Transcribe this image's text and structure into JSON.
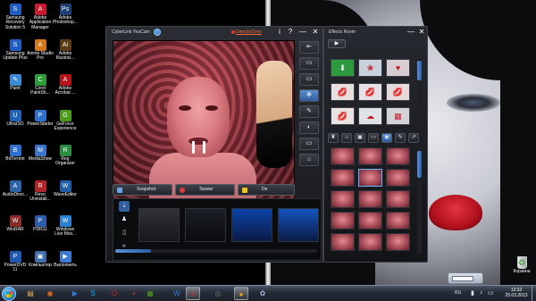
{
  "desktop": {
    "icons": [
      {
        "label": "Samsung Recovery Solution 5",
        "glyph": "S",
        "color": "#1f5fc4"
      },
      {
        "label": "Adobe Application Manager",
        "glyph": "A",
        "color": "#c8192e"
      },
      {
        "label": "Adobe Photoshop...",
        "glyph": "Ps",
        "color": "#1d3f73"
      },
      {
        "label": "Samsung Update Plus",
        "glyph": "S",
        "color": "#1f5fc4"
      },
      {
        "label": "Anime Studio Pro",
        "glyph": "A",
        "color": "#d47a1c"
      },
      {
        "label": "Adobe Illustrat...",
        "glyph": "Ai",
        "color": "#5b3b13"
      },
      {
        "label": "Paint",
        "glyph": "✎",
        "color": "#3a8ad6"
      },
      {
        "label": "Corel PaintSh...",
        "glyph": "C",
        "color": "#2f9a3a"
      },
      {
        "label": "Adobe Acrobat ...",
        "glyph": "A",
        "color": "#b8131d"
      },
      {
        "label": "UltraISO",
        "glyph": "U",
        "color": "#2063b7"
      },
      {
        "label": "PowerStarter",
        "glyph": "P",
        "color": "#2f6fd0"
      },
      {
        "label": "GeForce Experience",
        "glyph": "G",
        "color": "#4c9b1c"
      },
      {
        "label": "BitTorrent",
        "glyph": "B",
        "color": "#2f6fd0"
      },
      {
        "label": "MediaShow",
        "glyph": "M",
        "color": "#3c74c9"
      },
      {
        "label": "Reg Organizer",
        "glyph": "R",
        "color": "#2b8d3f"
      },
      {
        "label": "AudioDirec...",
        "glyph": "A",
        "color": "#2c63a8"
      },
      {
        "label": "Revo Uninstall...",
        "glyph": "R",
        "color": "#b02626"
      },
      {
        "label": "WaveEditor",
        "glyph": "W",
        "color": "#1f5fa8"
      },
      {
        "label": "WinRAR",
        "glyph": "W",
        "color": "#8b2a2a"
      },
      {
        "label": "PDR11",
        "glyph": "P",
        "color": "#2b5ca7"
      },
      {
        "label": "Windows Live Mov...",
        "glyph": "W",
        "color": "#2a7fd0"
      },
      {
        "label": "PowerDVD 11",
        "glyph": "P",
        "color": "#1d5bb3"
      },
      {
        "label": "Компьютер",
        "glyph": "▣",
        "color": "#3d6fa8"
      },
      {
        "label": "Выполнить",
        "glyph": "▶",
        "color": "#3a7ad0"
      }
    ],
    "recycle_bin_label": "Корзина"
  },
  "youcam": {
    "title": "CyberLink YouCam",
    "directorzone_label": "DirectorZone",
    "help_glyph": "?",
    "info_glyph": "i",
    "minimize_glyph": "—",
    "close_glyph": "✕",
    "snapshot_label": "Snapshot",
    "record_label": "Захват",
    "third_button_label": "De",
    "side_tools": [
      "⇤",
      "▭",
      "▭",
      "❃",
      "✎",
      "◐",
      "▭",
      "⌂"
    ],
    "filmstrip_nav": [
      "⇣",
      "♟",
      "▯",
      "»"
    ]
  },
  "effects_room": {
    "title": "Effects Room",
    "category_glyph": "▶",
    "minimize_glyph": "—",
    "close_glyph": "✕",
    "effect_tiles": [
      {
        "glyph": "⬇",
        "color": "#2c9a3f"
      },
      {
        "glyph": "❀",
        "color": "#c9d1dc"
      },
      {
        "glyph": "♥",
        "color": "#d8cdd0"
      },
      {
        "glyph": "💋",
        "color": "#e8dfe0"
      },
      {
        "glyph": "💋",
        "color": "#e6e1e4"
      },
      {
        "glyph": "💋",
        "color": "#e8dadc"
      },
      {
        "glyph": "💋",
        "color": "#e9e2e3"
      },
      {
        "glyph": "☁",
        "color": "#dfe3e8"
      },
      {
        "glyph": "▦",
        "color": "#d2d4d8"
      }
    ],
    "tabs": [
      "♜",
      "⌂",
      "▣",
      "▭",
      "◉",
      "✎",
      "↗"
    ]
  },
  "taskbar": {
    "apps": [
      {
        "name": "explorer",
        "glyph": "▤",
        "color": "#e0b54a"
      },
      {
        "name": "firefox",
        "glyph": "◉",
        "color": "#e86a1f"
      },
      {
        "name": "windows-media",
        "glyph": "▶",
        "color": "#2f7fd6"
      },
      {
        "name": "skype",
        "glyph": "S",
        "color": "#00aff0"
      },
      {
        "name": "opera",
        "glyph": "O",
        "color": "#d2232a"
      },
      {
        "name": "add",
        "glyph": "+",
        "color": "#c93636"
      },
      {
        "name": "photos",
        "glyph": "▦",
        "color": "#4c9b1c"
      },
      {
        "name": "windows-live",
        "glyph": "W",
        "color": "#2f7fd6"
      },
      {
        "name": "virtual",
        "glyph": "V",
        "color": "#d8232a"
      },
      {
        "name": "browser",
        "glyph": "◎",
        "color": "#777"
      },
      {
        "name": "youcam",
        "glyph": "●",
        "color": "#f2a20c"
      },
      {
        "name": "app",
        "glyph": "✿",
        "color": "#9fb6d6"
      }
    ],
    "tray_language": "RU",
    "time": "12:32",
    "date": "25.03.2013"
  }
}
